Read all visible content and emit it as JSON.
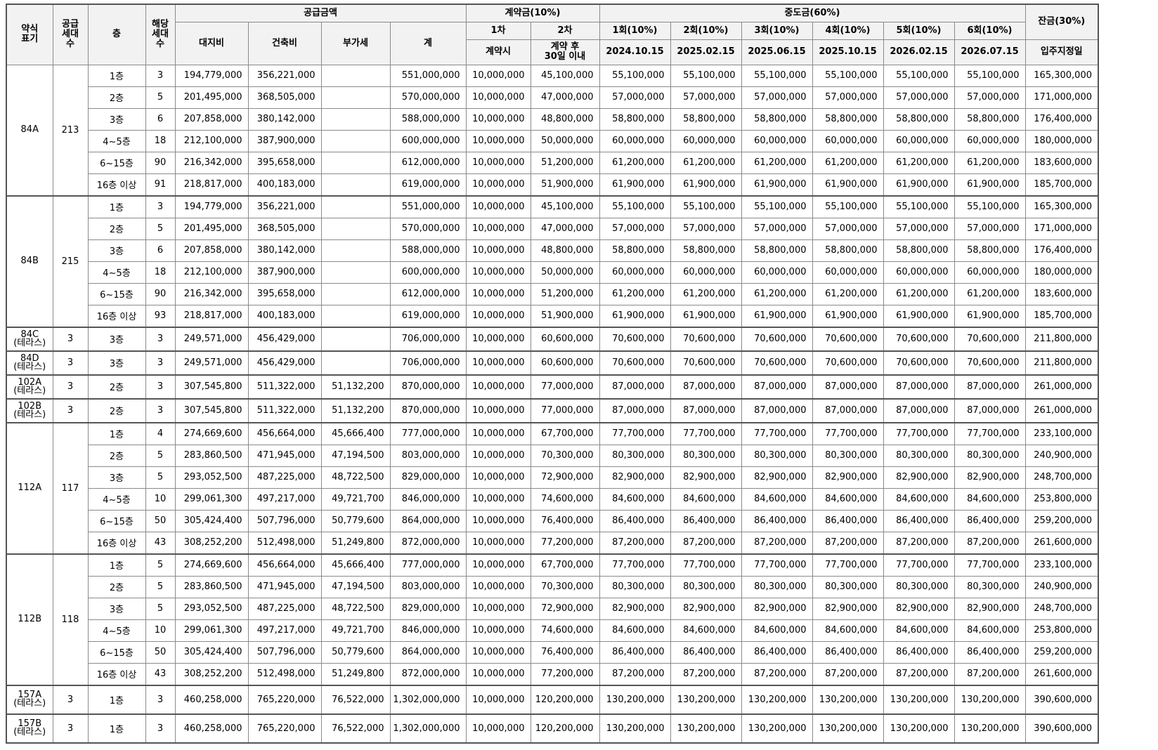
{
  "headers": {
    "type": "약식\n표기",
    "supply_units": "공급\n세대\n수",
    "floor": "층",
    "units": "해당\n세대\n수",
    "supply_amount": "공급금액",
    "land": "대지비",
    "building": "건축비",
    "vat": "부가세",
    "total": "계",
    "deposit": "계약금(10%)",
    "dep1": "1차",
    "dep2": "2차",
    "dep1_when": "계약시",
    "dep2_when": "계약 후\n30일 이내",
    "middle": "중도금(60%)",
    "mid_cols": [
      {
        "label": "1회(10%)",
        "date": "2024.10.15"
      },
      {
        "label": "2회(10%)",
        "date": "2025.02.15"
      },
      {
        "label": "3회(10%)",
        "date": "2025.06.15"
      },
      {
        "label": "4회(10%)",
        "date": "2025.10.15"
      },
      {
        "label": "5회(10%)",
        "date": "2026.02.15"
      },
      {
        "label": "6회(10%)",
        "date": "2026.07.15"
      }
    ],
    "balance": "잔금(30%)",
    "balance_when": "입주지정일"
  },
  "groups": [
    {
      "type": "84A",
      "supply": "213",
      "rows": [
        {
          "floor": "1층",
          "units": "3",
          "land": "194,779,000",
          "building": "356,221,000",
          "vat": "",
          "total": "551,000,000",
          "d1": "10,000,000",
          "d2": "45,100,000",
          "mid": "55,100,000",
          "bal": "165,300,000"
        },
        {
          "floor": "2층",
          "units": "5",
          "land": "201,495,000",
          "building": "368,505,000",
          "vat": "",
          "total": "570,000,000",
          "d1": "10,000,000",
          "d2": "47,000,000",
          "mid": "57,000,000",
          "bal": "171,000,000"
        },
        {
          "floor": "3층",
          "units": "6",
          "land": "207,858,000",
          "building": "380,142,000",
          "vat": "",
          "total": "588,000,000",
          "d1": "10,000,000",
          "d2": "48,800,000",
          "mid": "58,800,000",
          "bal": "176,400,000"
        },
        {
          "floor": "4~5층",
          "units": "18",
          "land": "212,100,000",
          "building": "387,900,000",
          "vat": "",
          "total": "600,000,000",
          "d1": "10,000,000",
          "d2": "50,000,000",
          "mid": "60,000,000",
          "bal": "180,000,000"
        },
        {
          "floor": "6~15층",
          "units": "90",
          "land": "216,342,000",
          "building": "395,658,000",
          "vat": "",
          "total": "612,000,000",
          "d1": "10,000,000",
          "d2": "51,200,000",
          "mid": "61,200,000",
          "bal": "183,600,000"
        },
        {
          "floor": "16층 이상",
          "units": "91",
          "land": "218,817,000",
          "building": "400,183,000",
          "vat": "",
          "total": "619,000,000",
          "d1": "10,000,000",
          "d2": "51,900,000",
          "mid": "61,900,000",
          "bal": "185,700,000"
        }
      ]
    },
    {
      "type": "84B",
      "supply": "215",
      "rows": [
        {
          "floor": "1층",
          "units": "3",
          "land": "194,779,000",
          "building": "356,221,000",
          "vat": "",
          "total": "551,000,000",
          "d1": "10,000,000",
          "d2": "45,100,000",
          "mid": "55,100,000",
          "bal": "165,300,000"
        },
        {
          "floor": "2층",
          "units": "5",
          "land": "201,495,000",
          "building": "368,505,000",
          "vat": "",
          "total": "570,000,000",
          "d1": "10,000,000",
          "d2": "47,000,000",
          "mid": "57,000,000",
          "bal": "171,000,000"
        },
        {
          "floor": "3층",
          "units": "6",
          "land": "207,858,000",
          "building": "380,142,000",
          "vat": "",
          "total": "588,000,000",
          "d1": "10,000,000",
          "d2": "48,800,000",
          "mid": "58,800,000",
          "bal": "176,400,000"
        },
        {
          "floor": "4~5층",
          "units": "18",
          "land": "212,100,000",
          "building": "387,900,000",
          "vat": "",
          "total": "600,000,000",
          "d1": "10,000,000",
          "d2": "50,000,000",
          "mid": "60,000,000",
          "bal": "180,000,000"
        },
        {
          "floor": "6~15층",
          "units": "90",
          "land": "216,342,000",
          "building": "395,658,000",
          "vat": "",
          "total": "612,000,000",
          "d1": "10,000,000",
          "d2": "51,200,000",
          "mid": "61,200,000",
          "bal": "183,600,000"
        },
        {
          "floor": "16층 이상",
          "units": "93",
          "land": "218,817,000",
          "building": "400,183,000",
          "vat": "",
          "total": "619,000,000",
          "d1": "10,000,000",
          "d2": "51,900,000",
          "mid": "61,900,000",
          "bal": "185,700,000"
        }
      ]
    },
    {
      "type": "84C\n(테라스)",
      "supply": "3",
      "rows": [
        {
          "floor": "3층",
          "units": "3",
          "land": "249,571,000",
          "building": "456,429,000",
          "vat": "",
          "total": "706,000,000",
          "d1": "10,000,000",
          "d2": "60,600,000",
          "mid": "70,600,000",
          "bal": "211,800,000"
        }
      ]
    },
    {
      "type": "84D\n(테라스)",
      "supply": "3",
      "rows": [
        {
          "floor": "3층",
          "units": "3",
          "land": "249,571,000",
          "building": "456,429,000",
          "vat": "",
          "total": "706,000,000",
          "d1": "10,000,000",
          "d2": "60,600,000",
          "mid": "70,600,000",
          "bal": "211,800,000"
        }
      ]
    },
    {
      "type": "102A\n(테라스)",
      "supply": "3",
      "rows": [
        {
          "floor": "2층",
          "units": "3",
          "land": "307,545,800",
          "building": "511,322,000",
          "vat": "51,132,200",
          "total": "870,000,000",
          "d1": "10,000,000",
          "d2": "77,000,000",
          "mid": "87,000,000",
          "bal": "261,000,000"
        }
      ]
    },
    {
      "type": "102B\n(테라스)",
      "supply": "3",
      "rows": [
        {
          "floor": "2층",
          "units": "3",
          "land": "307,545,800",
          "building": "511,322,000",
          "vat": "51,132,200",
          "total": "870,000,000",
          "d1": "10,000,000",
          "d2": "77,000,000",
          "mid": "87,000,000",
          "bal": "261,000,000"
        }
      ]
    },
    {
      "type": "112A",
      "supply": "117",
      "rows": [
        {
          "floor": "1층",
          "units": "4",
          "land": "274,669,600",
          "building": "456,664,000",
          "vat": "45,666,400",
          "total": "777,000,000",
          "d1": "10,000,000",
          "d2": "67,700,000",
          "mid": "77,700,000",
          "bal": "233,100,000"
        },
        {
          "floor": "2층",
          "units": "5",
          "land": "283,860,500",
          "building": "471,945,000",
          "vat": "47,194,500",
          "total": "803,000,000",
          "d1": "10,000,000",
          "d2": "70,300,000",
          "mid": "80,300,000",
          "bal": "240,900,000"
        },
        {
          "floor": "3층",
          "units": "5",
          "land": "293,052,500",
          "building": "487,225,000",
          "vat": "48,722,500",
          "total": "829,000,000",
          "d1": "10,000,000",
          "d2": "72,900,000",
          "mid": "82,900,000",
          "bal": "248,700,000"
        },
        {
          "floor": "4~5층",
          "units": "10",
          "land": "299,061,300",
          "building": "497,217,000",
          "vat": "49,721,700",
          "total": "846,000,000",
          "d1": "10,000,000",
          "d2": "74,600,000",
          "mid": "84,600,000",
          "bal": "253,800,000"
        },
        {
          "floor": "6~15층",
          "units": "50",
          "land": "305,424,400",
          "building": "507,796,000",
          "vat": "50,779,600",
          "total": "864,000,000",
          "d1": "10,000,000",
          "d2": "76,400,000",
          "mid": "86,400,000",
          "bal": "259,200,000"
        },
        {
          "floor": "16층 이상",
          "units": "43",
          "land": "308,252,200",
          "building": "512,498,000",
          "vat": "51,249,800",
          "total": "872,000,000",
          "d1": "10,000,000",
          "d2": "77,200,000",
          "mid": "87,200,000",
          "bal": "261,600,000"
        }
      ]
    },
    {
      "type": "112B",
      "supply": "118",
      "rows": [
        {
          "floor": "1층",
          "units": "5",
          "land": "274,669,600",
          "building": "456,664,000",
          "vat": "45,666,400",
          "total": "777,000,000",
          "d1": "10,000,000",
          "d2": "67,700,000",
          "mid": "77,700,000",
          "bal": "233,100,000"
        },
        {
          "floor": "2층",
          "units": "5",
          "land": "283,860,500",
          "building": "471,945,000",
          "vat": "47,194,500",
          "total": "803,000,000",
          "d1": "10,000,000",
          "d2": "70,300,000",
          "mid": "80,300,000",
          "bal": "240,900,000"
        },
        {
          "floor": "3층",
          "units": "5",
          "land": "293,052,500",
          "building": "487,225,000",
          "vat": "48,722,500",
          "total": "829,000,000",
          "d1": "10,000,000",
          "d2": "72,900,000",
          "mid": "82,900,000",
          "bal": "248,700,000"
        },
        {
          "floor": "4~5층",
          "units": "10",
          "land": "299,061,300",
          "building": "497,217,000",
          "vat": "49,721,700",
          "total": "846,000,000",
          "d1": "10,000,000",
          "d2": "74,600,000",
          "mid": "84,600,000",
          "bal": "253,800,000"
        },
        {
          "floor": "6~15층",
          "units": "50",
          "land": "305,424,400",
          "building": "507,796,000",
          "vat": "50,779,600",
          "total": "864,000,000",
          "d1": "10,000,000",
          "d2": "76,400,000",
          "mid": "86,400,000",
          "bal": "259,200,000"
        },
        {
          "floor": "16층 이상",
          "units": "43",
          "land": "308,252,200",
          "building": "512,498,000",
          "vat": "51,249,800",
          "total": "872,000,000",
          "d1": "10,000,000",
          "d2": "77,200,000",
          "mid": "87,200,000",
          "bal": "261,600,000"
        }
      ]
    },
    {
      "type": "157A\n(테라스)",
      "supply": "3",
      "rows": [
        {
          "floor": "1층",
          "units": "3",
          "land": "460,258,000",
          "building": "765,220,000",
          "vat": "76,522,000",
          "total": "1,302,000,000",
          "d1": "10,000,000",
          "d2": "120,200,000",
          "mid": "130,200,000",
          "bal": "390,600,000"
        }
      ]
    },
    {
      "type": "157B\n(테라스)",
      "supply": "3",
      "rows": [
        {
          "floor": "1층",
          "units": "3",
          "land": "460,258,000",
          "building": "765,220,000",
          "vat": "76,522,000",
          "total": "1,302,000,000",
          "d1": "10,000,000",
          "d2": "120,200,000",
          "mid": "130,200,000",
          "bal": "390,600,000"
        }
      ]
    }
  ]
}
